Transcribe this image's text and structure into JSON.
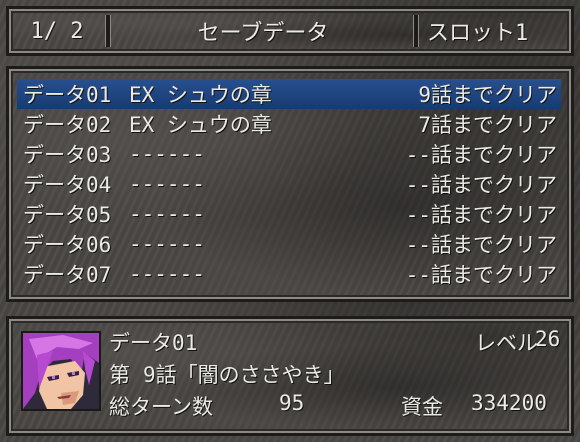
{
  "header": {
    "page": "1/ 2",
    "title": "セーブデータ",
    "slot": "スロット1"
  },
  "save_list": [
    {
      "id": "データ01",
      "title": "EX シュウの章",
      "progress": "9話までクリア",
      "selected": true
    },
    {
      "id": "データ02",
      "title": "EX シュウの章",
      "progress": "7話までクリア",
      "selected": false
    },
    {
      "id": "データ03",
      "title": "------",
      "progress": "--話までクリア",
      "selected": false
    },
    {
      "id": "データ04",
      "title": "------",
      "progress": "--話までクリア",
      "selected": false
    },
    {
      "id": "データ05",
      "title": "------",
      "progress": "--話までクリア",
      "selected": false
    },
    {
      "id": "データ06",
      "title": "------",
      "progress": "--話までクリア",
      "selected": false
    },
    {
      "id": "データ07",
      "title": "------",
      "progress": "--話までクリア",
      "selected": false
    }
  ],
  "details": {
    "name": "データ01",
    "level_label": "レベル",
    "level_value": "26",
    "chapter_label": "第",
    "chapter_value": "9話「闇のささやき」",
    "turns_label": "総ターン数",
    "turns_value": "95",
    "funds_label": "資金",
    "funds_value": "334200",
    "portrait": "character-portrait-purple-hair"
  },
  "colors": {
    "selection": "#1f4786",
    "frame_light": "#8d8a86",
    "frame_dark": "#1e1c1b",
    "text": "#ecebe6"
  }
}
